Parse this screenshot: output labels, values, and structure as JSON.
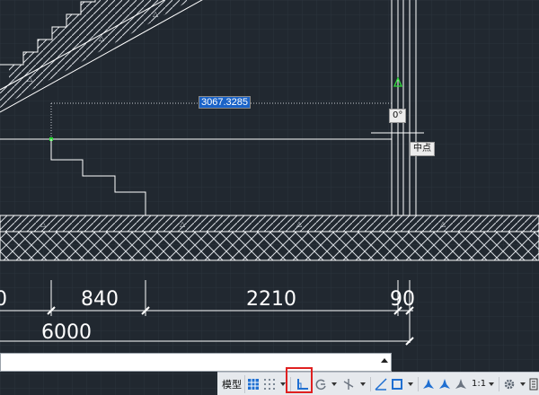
{
  "drawing": {
    "dimensions": [
      "0",
      "840",
      "2210",
      "90",
      "6000"
    ],
    "dynamic_input_value": "3067.3285",
    "angle_tooltip": "0°",
    "snap_tooltip": "中点"
  },
  "command_line": {
    "value": ""
  },
  "status_bar": {
    "model_tab": "模型",
    "scale": "1:1",
    "highlighted_tool": "ortho-mode",
    "colors": {
      "accent": "#1f6fd1",
      "highlight": "#e02020",
      "background": "#212830",
      "lines": "#ffffff"
    }
  }
}
